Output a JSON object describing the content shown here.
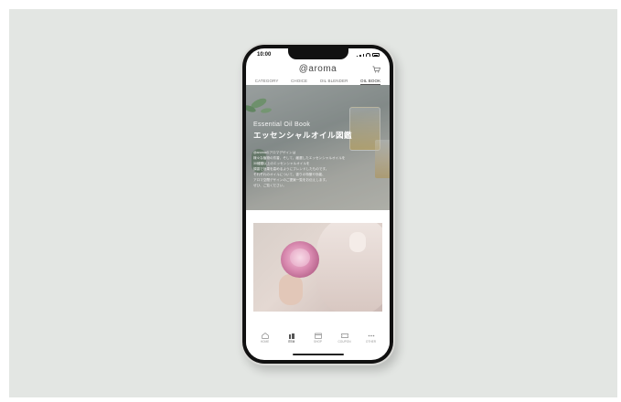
{
  "status_bar": {
    "time": "10:00"
  },
  "header": {
    "brand": "@aroma"
  },
  "tabs": [
    {
      "label": "CATEGORY",
      "active": false
    },
    {
      "label": "CHOICE",
      "active": false
    },
    {
      "label": "OIL BLENDER",
      "active": false
    },
    {
      "label": "OIL BOOK",
      "active": true
    }
  ],
  "hero": {
    "subtitle": "Essential Oil Book",
    "title": "エッセンシャルオイル図鑑",
    "body_lines": [
      "@aromaのアロマデザインは",
      "様々な植物の芳香、そして、厳選したエッセンシャルオイルを",
      "30種類以上のエッセンシャルオイルを",
      "調香で効果を高めるようにブレンドしたものです。",
      "それぞれのオイルについて、香りの特徴や効能、",
      "アロマ空間デザインのご提案一覧をお伝えします。",
      "ぜひ、ご覧ください。"
    ]
  },
  "bottom_nav": [
    {
      "icon": "home-icon",
      "label": "HOME",
      "active": false
    },
    {
      "icon": "item-icon",
      "label": "ITEM",
      "active": true
    },
    {
      "icon": "shop-icon",
      "label": "SHOP",
      "active": false
    },
    {
      "icon": "coupon-icon",
      "label": "COUPON",
      "active": false
    },
    {
      "icon": "more-icon",
      "label": "OTHER",
      "active": false
    }
  ],
  "colors": {
    "backdrop": "#e3e6e3",
    "phone_frame": "#d9d9d6",
    "screen_bg": "#ffffff"
  }
}
